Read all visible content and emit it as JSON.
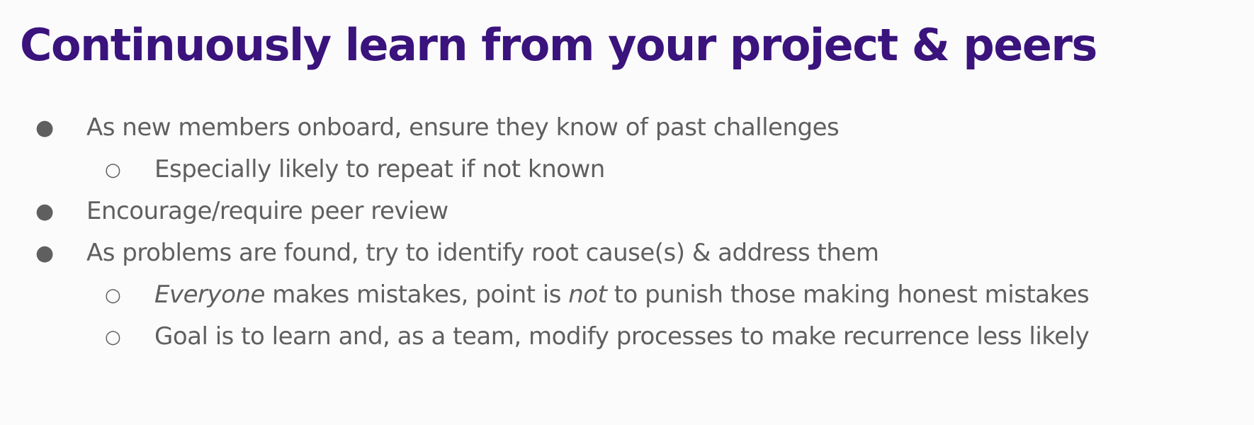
{
  "slide": {
    "title": "Continuously learn from your project & peers",
    "bullet_level1": "●",
    "bullet_level2": "○",
    "items": [
      {
        "level": 1,
        "text": "As new members onboard, ensure they know of past challenges"
      },
      {
        "level": 2,
        "text": "Especially likely to repeat if not known"
      },
      {
        "level": 1,
        "text": "Encourage/require peer review"
      },
      {
        "level": 1,
        "text": "As problems are found, try to identify root cause(s) & address them"
      },
      {
        "level": 2,
        "parts": [
          {
            "text": "Everyone",
            "italic": true
          },
          {
            "text": " makes mistakes, point is ",
            "italic": false
          },
          {
            "text": "not",
            "italic": true
          },
          {
            "text": " to punish those making honest mistakes",
            "italic": false
          }
        ]
      },
      {
        "level": 2,
        "text": "Goal is to learn and, as a team, modify processes to make recurrence less likely"
      }
    ],
    "colors": {
      "title": "#3a137d",
      "body": "#5f5f5f",
      "background": "#fbfbfb"
    }
  }
}
